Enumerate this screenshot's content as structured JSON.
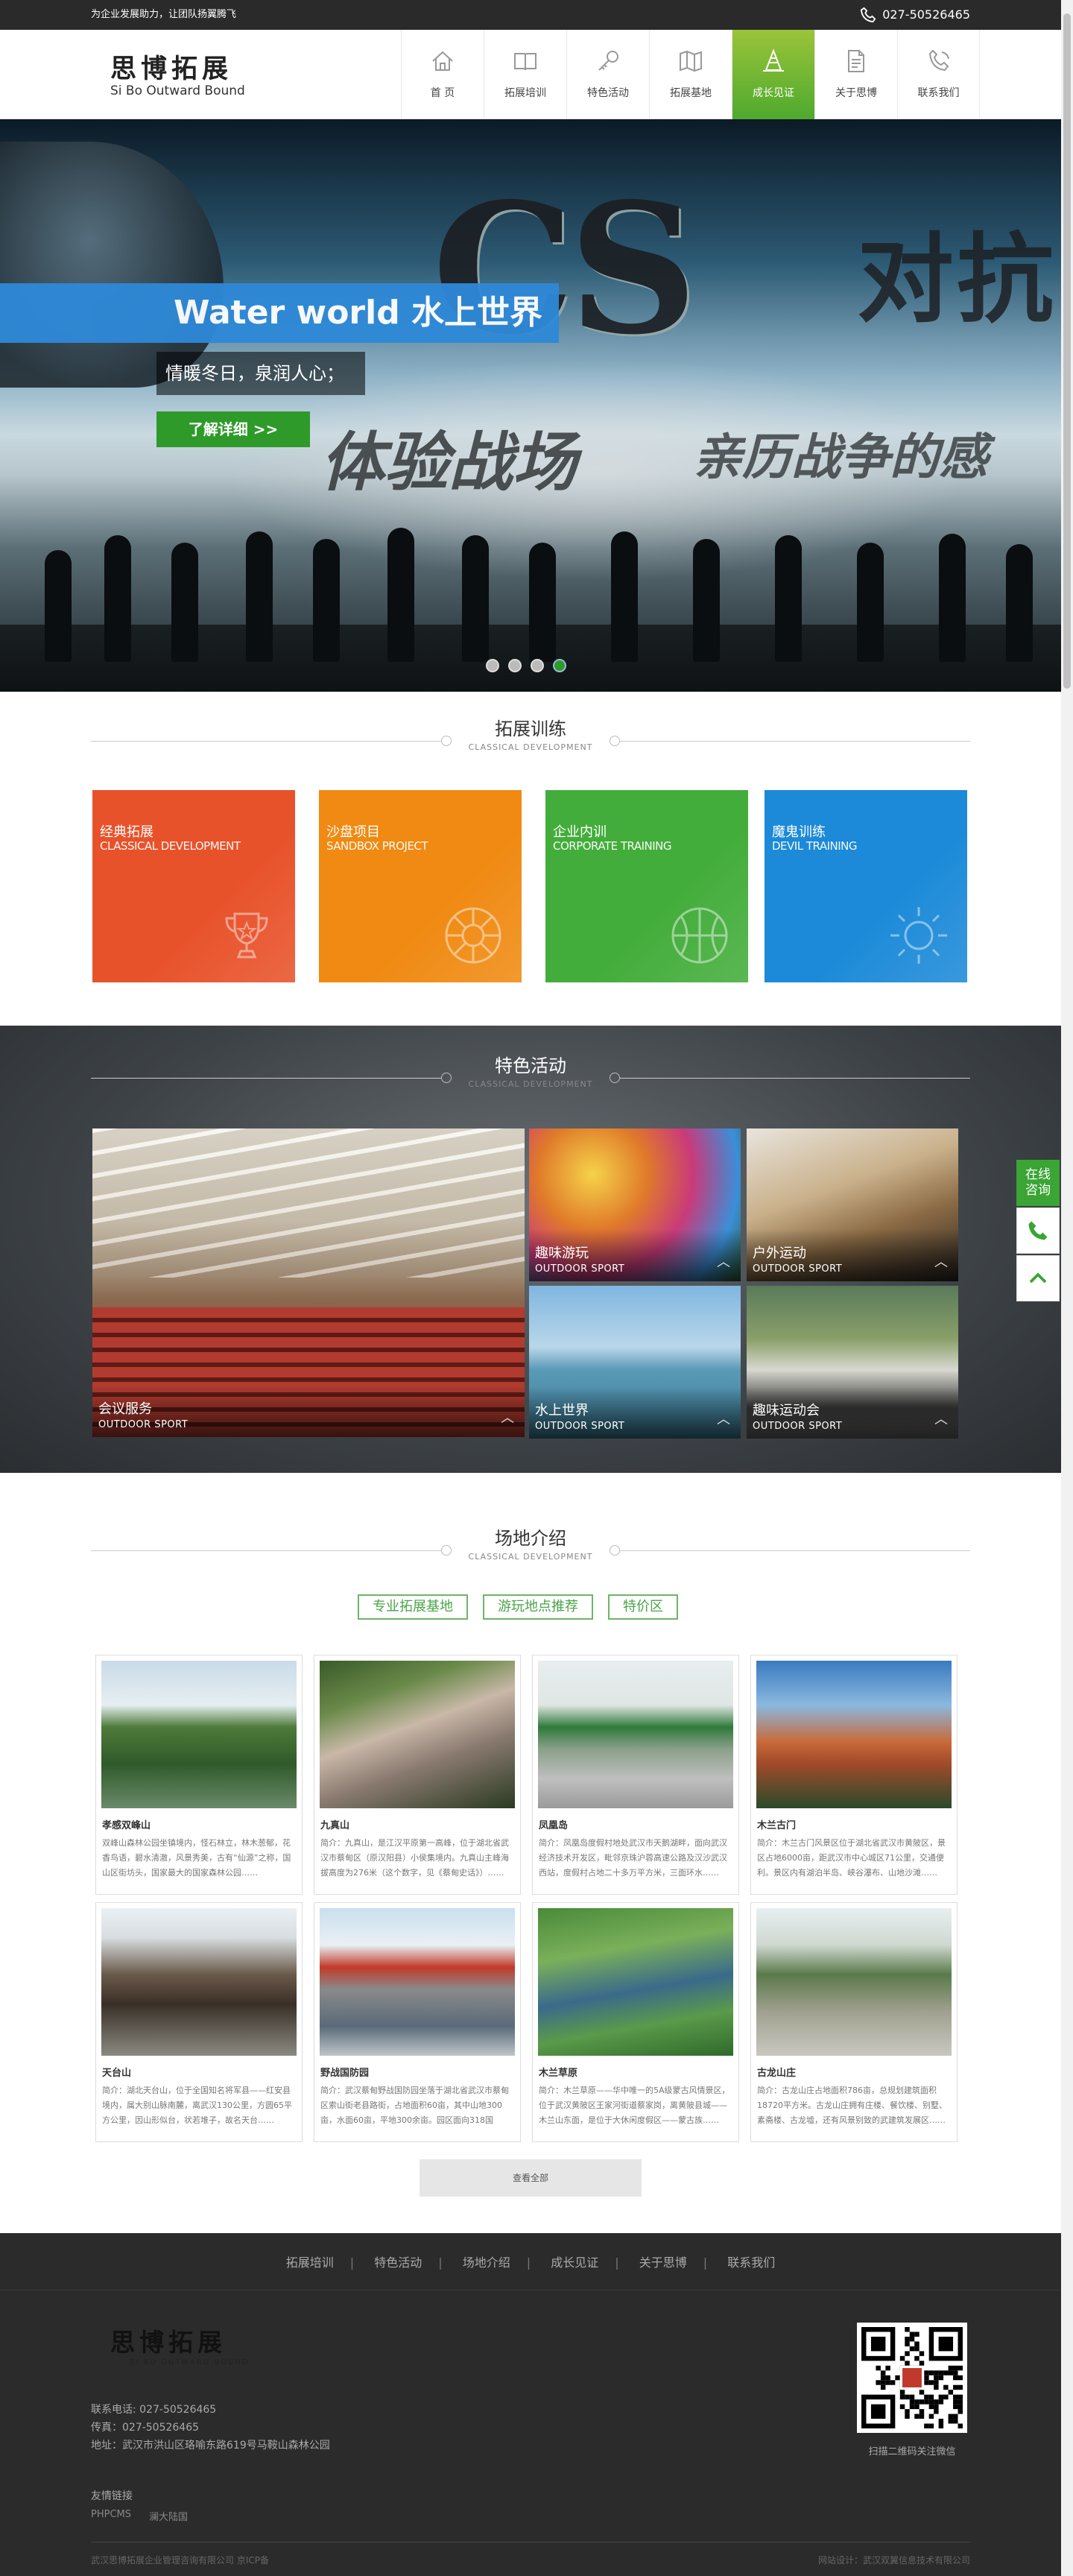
{
  "topbar": {
    "slogan": "为企业发展助力，让团队扬翼腾飞",
    "phone": "027-50526465"
  },
  "logo": {
    "cn": "思博拓展",
    "en": "Si Bo Outward Bound"
  },
  "nav": [
    {
      "label": "首 页",
      "icon": "home-icon"
    },
    {
      "label": "拓展培训",
      "icon": "book-icon"
    },
    {
      "label": "特色活动",
      "icon": "key-icon"
    },
    {
      "label": "拓展基地",
      "icon": "map-icon"
    },
    {
      "label": "成长见证",
      "icon": "cone-icon"
    },
    {
      "label": "关于思博",
      "icon": "document-icon"
    },
    {
      "label": "联系我们",
      "icon": "phone-icon"
    }
  ],
  "banner": {
    "title": "Water world 水上世界",
    "subtitle": "情暖冬日，泉润人心；",
    "button": "了解详细 >>",
    "image_text": {
      "cs": "CS",
      "duikang": "对抗",
      "tiyan": "体验战场",
      "qinli": "亲历战争的感"
    },
    "slide_count": 4,
    "active_slide": 4
  },
  "training": {
    "title": "拓展训练",
    "en": "CLASSICAL DEVELOPMENT",
    "cards": [
      {
        "name": "经典拓展",
        "en": "CLASSICAL DEVELOPMENT",
        "color": "#e8522a",
        "icon": "trophy-icon"
      },
      {
        "name": "沙盘项目",
        "en": "SANDBOX PROJECT",
        "color": "#f08a12",
        "icon": "wheel-icon"
      },
      {
        "name": "企业内训",
        "en": "CORPORATE TRAINING",
        "color": "#43ad3b",
        "icon": "ball-icon"
      },
      {
        "name": "魔鬼训练",
        "en": "DEVIL TRAINING",
        "color": "#1c8ad8",
        "icon": "sun-icon"
      }
    ]
  },
  "activities": {
    "title": "特色活动",
    "en": "CLASSICAL DEVELOPMENT",
    "items": [
      {
        "name": "会议服务",
        "en": "OUTDOOR SPORT"
      },
      {
        "name": "趣味游玩",
        "en": "OUTDOOR SPORT"
      },
      {
        "name": "户外运动",
        "en": "OUTDOOR SPORT"
      },
      {
        "name": "水上世界",
        "en": "OUTDOOR SPORT"
      },
      {
        "name": "趣味运动会",
        "en": "OUTDOOR SPORT"
      }
    ]
  },
  "venues": {
    "title": "场地介绍",
    "en": "CLASSICAL DEVELOPMENT",
    "tabs": [
      "专业拓展基地",
      "游玩地点推荐",
      "特价区"
    ],
    "items": [
      {
        "name": "孝感双峰山",
        "desc": "双峰山森林公园坐镇境内，怪石林立，林木葱郁，花香鸟语，碧水清澈，风景秀美，古有“仙源”之称，国山区街坊头，国家最大的国家森林公园……"
      },
      {
        "name": "九真山",
        "desc": "简介：九真山，是江汉平原第一高峰，位于湖北省武汉市蔡甸区（原汉阳县）小侯集境内。九真山主峰海拔高度为276米（这个数字，见《蔡甸史话》）……"
      },
      {
        "name": "凤凰岛",
        "desc": "简介：凤凰岛度假村地处武汉市天鹅湖畔，面向武汉经济技术开发区，毗邻京珠沪蓉高速公路及汉沙武汉西站，度假村占地二十多万平方米，三面环水……"
      },
      {
        "name": "木兰古门",
        "desc": "简介：木兰古门风景区位于湖北省武汉市黄陂区，景区占地6000亩，距武汉市中心城区71公里，交通便利。景区内有湖泊半岛、峡谷瀑布、山地沙滩……"
      },
      {
        "name": "天台山",
        "desc": "简介：湖北天台山，位于全国知名将军县——红安县境内，属大别山脉南麓，离武汉130公里，方圆65平方公里，因山形似台，状若堆子，故名天台……"
      },
      {
        "name": "野战国防园",
        "desc": "简介：武汉蔡甸野战国防园坐落于湖北省武汉市蔡甸区索山街老县路街，占地面积60亩，其中山地300亩，水面60亩，平地300余亩。园区面向318国道……"
      },
      {
        "name": "木兰草原",
        "desc": "简介：木兰草原——华中唯一的5A级蒙古风情景区，位于武汉黄陂区王家河街道蔡家岗，离黄陂县城——木兰山东面，是位于大休闲度假区——蒙古族……"
      },
      {
        "name": "古龙山庄",
        "desc": "简介：古龙山庄占地面积786亩，总规划建筑面积18720平方米。古龙山庄拥有庄楼、餐饮楼、别墅、素斋楼、古龙墟，还有风景别致的武建筑发展区……"
      }
    ],
    "more": "查看全部"
  },
  "footer": {
    "nav": [
      "拓展培训",
      "特色活动",
      "场地介绍",
      "成长见证",
      "关于思博",
      "联系我们"
    ],
    "logo_cn": "思博拓展",
    "logo_en": "SI BO OUTWARD BOUND",
    "phone": "联系电话: 027-50526465",
    "fax": "传真：027-50526465",
    "address": "地址：武汉市洪山区珞喻东路619号马鞍山森林公园",
    "qr_caption": "扫描二维码关注微信",
    "links_title": "友情链接",
    "links": [
      "PHPCMS",
      "澜大陆国"
    ],
    "copyright_left": "武汉思博拓展企业管理咨询有限公司  京ICP备",
    "copyright_right": "网站设计：武汉双翼信息技术有限公司"
  },
  "side": {
    "online": "在线\n咨询"
  },
  "colors": {
    "green": "#3aa535",
    "blue": "#2e89d8",
    "orange": "#f08a12",
    "red": "#e8522a",
    "dark": "#2b2b2b"
  }
}
